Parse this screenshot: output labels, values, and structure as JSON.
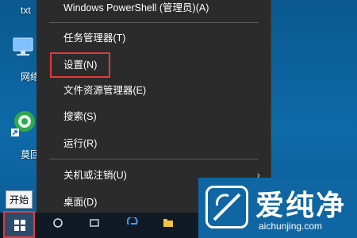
{
  "desktop": {
    "labels": {
      "top_file": "txt",
      "network": "网络",
      "app": "莫回"
    }
  },
  "taskbar": {
    "start_tooltip": "开始"
  },
  "context_menu": {
    "items": [
      {
        "label": "Windows PowerShell (管理员)(A)"
      },
      {
        "label": "任务管理器(T)"
      },
      {
        "label": "设置(N)",
        "highlighted": true
      },
      {
        "label": "文件资源管理器(E)"
      },
      {
        "label": "搜索(S)"
      },
      {
        "label": "运行(R)"
      },
      {
        "label": "关机或注销(U)",
        "has_submenu": true
      },
      {
        "label": "桌面(D)"
      }
    ]
  },
  "watermark": {
    "text_cn": "爱纯净",
    "url": "aichunjing.com"
  },
  "colors": {
    "menu_bg": "#2b2b2b",
    "highlight": "#e23b3b",
    "desktop_bg": "#0f6aa8"
  }
}
